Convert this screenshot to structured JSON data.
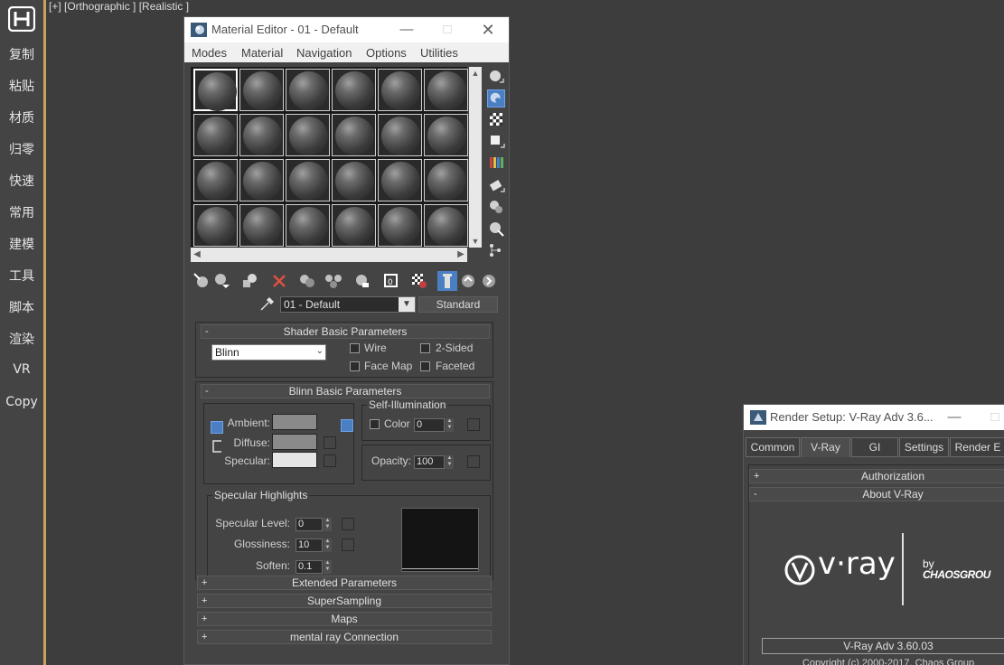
{
  "viewport": {
    "label": "[+] [Orthographic ] [Realistic ]"
  },
  "sidebar": {
    "logo": "3ds-max-logo",
    "items": [
      {
        "label": "复制"
      },
      {
        "label": "粘贴"
      },
      {
        "label": "材质"
      },
      {
        "label": "归零"
      },
      {
        "label": "快速"
      },
      {
        "label": "常用"
      },
      {
        "label": "建模"
      },
      {
        "label": "工具"
      },
      {
        "label": "脚本"
      },
      {
        "label": "渲染"
      },
      {
        "label": "VR"
      },
      {
        "label": "Copy"
      }
    ]
  },
  "material_editor": {
    "title": "Material Editor - 01 - Default",
    "menu": [
      "Modes",
      "Material",
      "Navigation",
      "Options",
      "Utilities"
    ],
    "material_name": "01 - Default",
    "material_type": "Standard",
    "shader_rollout": {
      "title": "Shader Basic Parameters",
      "sign": "-",
      "shader": "Blinn",
      "wire": "Wire",
      "two_sided": "2-Sided",
      "face_map": "Face Map",
      "faceted": "Faceted"
    },
    "blinn_rollout": {
      "title": "Blinn Basic Parameters",
      "sign": "-",
      "self_illum_title": "Self-Illumination",
      "color_label": "Color",
      "color_value": "0",
      "ambient_label": "Ambient:",
      "diffuse_label": "Diffuse:",
      "specular_label": "Specular:",
      "opacity_label": "Opacity:",
      "opacity_value": "100",
      "spec_highlights_title": "Specular Highlights",
      "spec_level_label": "Specular Level:",
      "spec_level_value": "0",
      "glossiness_label": "Glossiness:",
      "glossiness_value": "10",
      "soften_label": "Soften:",
      "soften_value": "0.1"
    },
    "collapsed_rollouts": [
      {
        "sign": "+",
        "title": "Extended Parameters"
      },
      {
        "sign": "+",
        "title": "SuperSampling"
      },
      {
        "sign": "+",
        "title": "Maps"
      },
      {
        "sign": "+",
        "title": "mental ray Connection"
      }
    ],
    "colors": {
      "ambient": "#8a8a8a",
      "diffuse": "#8a8a8a",
      "specular": "#e6e6e6",
      "accent": "#4b7fc4"
    }
  },
  "render_setup": {
    "title": "Render Setup: V-Ray Adv 3.6...",
    "tabs": [
      "Common",
      "V-Ray",
      "GI",
      "Settings",
      "Render E"
    ],
    "rollouts": [
      {
        "sign": "+",
        "title": "Authorization"
      },
      {
        "sign": "-",
        "title": "About V-Ray"
      }
    ],
    "logo_text": "v·ray",
    "by_text": "by",
    "chaos_text": "CHAOSGROU",
    "version": "V-Ray Adv 3.60.03",
    "copyright": "Copyright (c) 2000-2017, Chaos Group"
  }
}
